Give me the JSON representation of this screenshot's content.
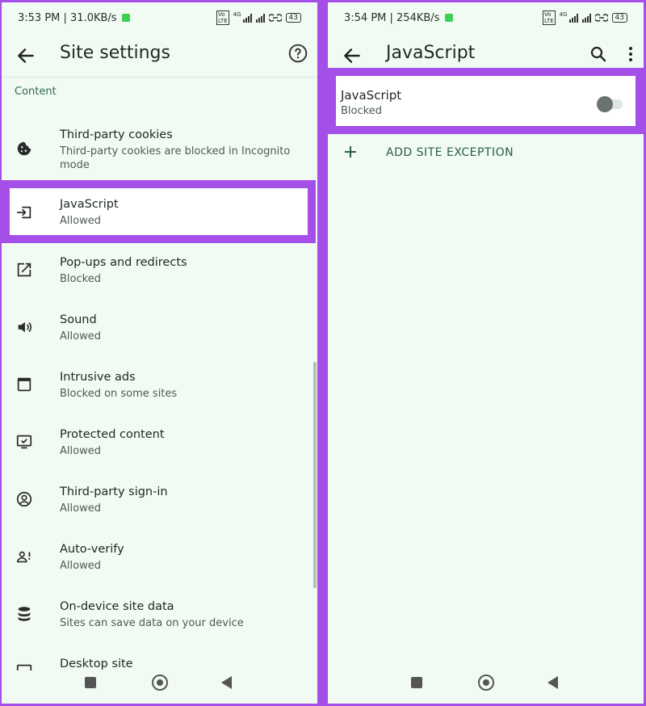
{
  "left": {
    "status": {
      "time": "3:53 PM | 31.0KB/s",
      "battery": "43"
    },
    "header": {
      "title": "Site settings"
    },
    "section_label": "Content",
    "items": [
      {
        "title": "Third-party cookies",
        "subtitle": "Third-party cookies are blocked in Incognito mode",
        "icon": "cookie-icon"
      },
      {
        "title": "JavaScript",
        "subtitle": "Allowed",
        "icon": "javascript-icon"
      },
      {
        "title": "Pop-ups and redirects",
        "subtitle": "Blocked",
        "icon": "popup-icon"
      },
      {
        "title": "Sound",
        "subtitle": "Allowed",
        "icon": "sound-icon"
      },
      {
        "title": "Intrusive ads",
        "subtitle": "Blocked on some sites",
        "icon": "ads-icon"
      },
      {
        "title": "Protected content",
        "subtitle": "Allowed",
        "icon": "protected-content-icon"
      },
      {
        "title": "Third-party sign-in",
        "subtitle": "Allowed",
        "icon": "sign-in-icon"
      },
      {
        "title": "Auto-verify",
        "subtitle": "Allowed",
        "icon": "auto-verify-icon"
      },
      {
        "title": "On-device site data",
        "subtitle": "Sites can save data on your device",
        "icon": "database-icon"
      },
      {
        "title": "Desktop site",
        "subtitle": "",
        "icon": "desktop-icon"
      }
    ]
  },
  "right": {
    "status": {
      "time": "3:54 PM | 254KB/s",
      "battery": "43"
    },
    "header": {
      "title": "JavaScript"
    },
    "js_setting": {
      "title": "JavaScript",
      "subtitle": "Blocked",
      "enabled": false
    },
    "add_exception_label": "ADD SITE EXCEPTION"
  },
  "colors": {
    "highlight": "#a54fe9",
    "background": "#f1fbf3",
    "accent": "#2f6a56"
  }
}
